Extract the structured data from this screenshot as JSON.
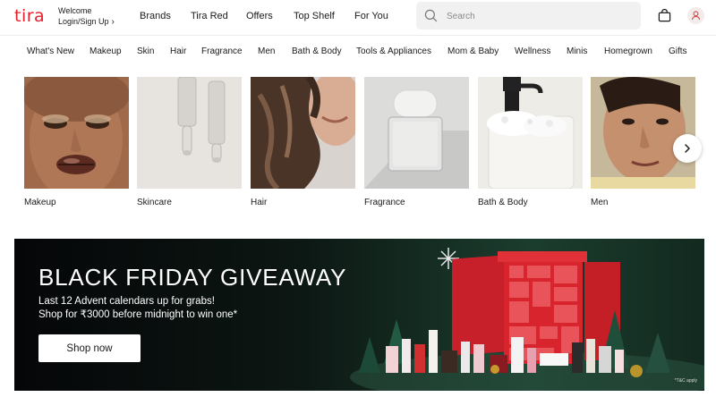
{
  "header": {
    "logo": "tira",
    "welcome": "Welcome",
    "login": "Login/Sign Up",
    "nav": [
      "Brands",
      "Tira Red",
      "Offers",
      "Top Shelf",
      "For You"
    ],
    "search_placeholder": "Search",
    "icons": [
      "search-icon",
      "shopping-bag-icon",
      "user-icon",
      "chevron-right-icon"
    ]
  },
  "categories_nav": [
    "What's New",
    "Makeup",
    "Skin",
    "Hair",
    "Fragrance",
    "Men",
    "Bath & Body",
    "Tools & Appliances",
    "Mom & Baby",
    "Wellness",
    "Minis",
    "Homegrown",
    "Gifts"
  ],
  "category_cards": [
    {
      "label": "Makeup"
    },
    {
      "label": "Skincare"
    },
    {
      "label": "Hair"
    },
    {
      "label": "Fragrance"
    },
    {
      "label": "Bath & Body"
    },
    {
      "label": "Men"
    }
  ],
  "banner": {
    "title": "BLACK FRIDAY GIVEAWAY",
    "line1": "Last 12 Advent calendars up for grabs!",
    "line2": "Shop for ₹3000 before midnight to win one*",
    "cta": "Shop now",
    "tc": "*T&C apply"
  },
  "colors": {
    "brand": "#e4212b",
    "banner_bg": "#0c1612",
    "calendar_red": "#d8242c"
  }
}
